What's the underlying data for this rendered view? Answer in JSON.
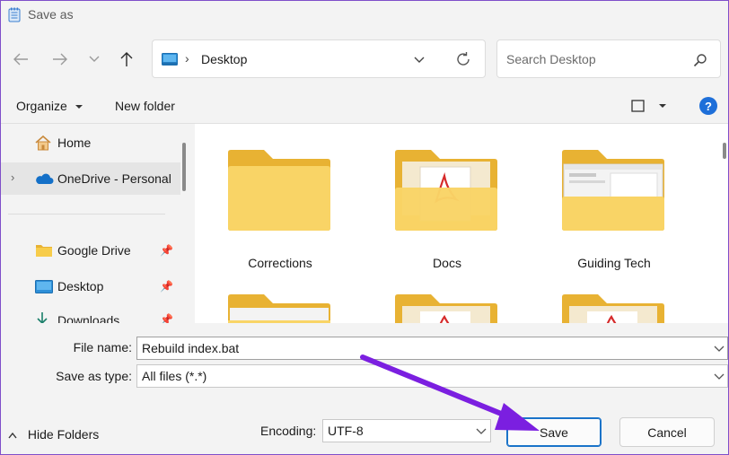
{
  "window": {
    "title": "Save as"
  },
  "nav": {
    "back_icon": "arrow-left-icon",
    "forward_icon": "arrow-right-icon",
    "recent_icon": "chevron-down-icon",
    "up_icon": "arrow-up-icon"
  },
  "address": {
    "location": "Desktop"
  },
  "search": {
    "placeholder": "Search Desktop"
  },
  "commandbar": {
    "organize": "Organize",
    "new_folder": "New folder"
  },
  "sidebar": {
    "items": [
      {
        "label": "Home"
      },
      {
        "label": "OneDrive - Personal"
      },
      {
        "label": "Google Drive"
      },
      {
        "label": "Desktop"
      },
      {
        "label": "Downloads"
      }
    ]
  },
  "folders": [
    {
      "label": "Corrections"
    },
    {
      "label": "Docs"
    },
    {
      "label": "Guiding Tech"
    }
  ],
  "form": {
    "file_name_label": "File name:",
    "file_name_value": "Rebuild index.bat",
    "save_type_label": "Save as type:",
    "save_type_value": "All files  (*.*)",
    "encoding_label": "Encoding:",
    "encoding_value": "UTF-8"
  },
  "buttons": {
    "hide_folders": "Hide Folders",
    "save": "Save",
    "cancel": "Cancel"
  },
  "help": {
    "glyph": "?"
  },
  "colors": {
    "accent": "#1a73c9",
    "arrow": "#7b1fe0",
    "folder": "#f7cc4a"
  }
}
